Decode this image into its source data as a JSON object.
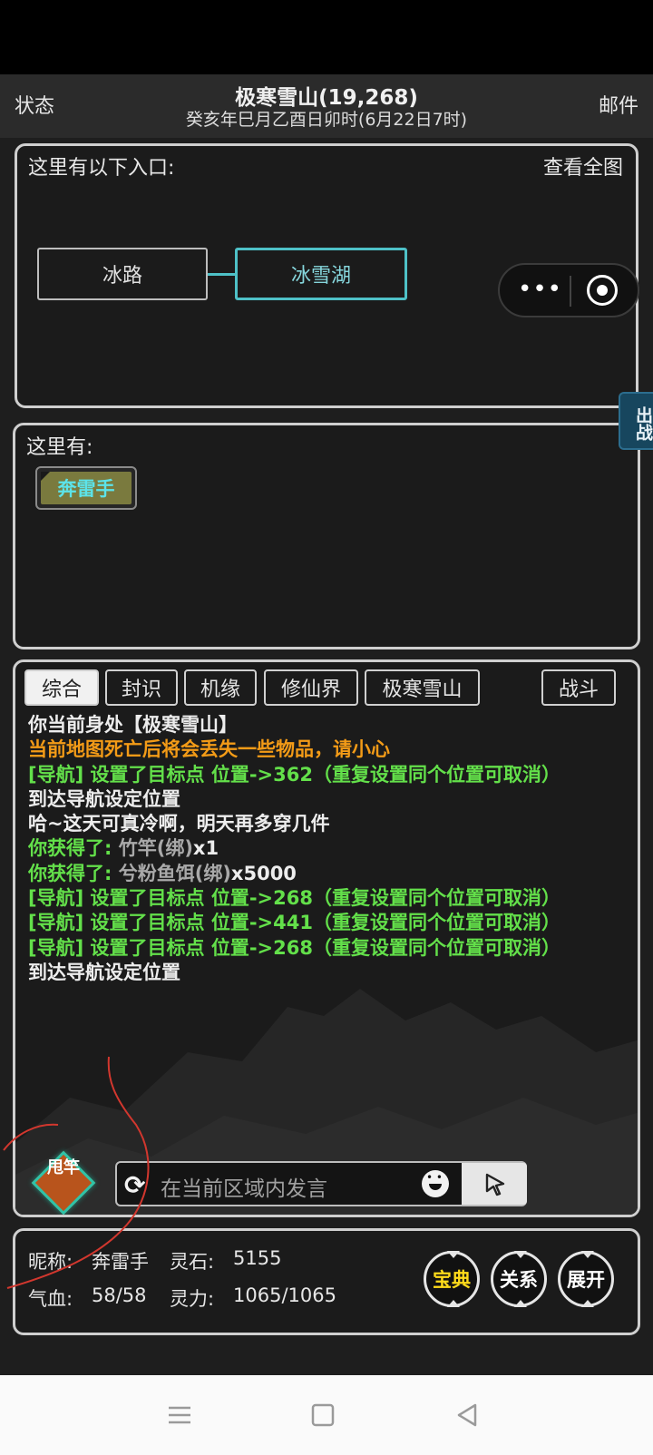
{
  "topbar": {
    "left": "状态",
    "title": "极寒雪山(19,268)",
    "subtitle": "癸亥年巳月乙酉日卯时(6月22日7时)",
    "right": "邮件"
  },
  "exits_panel": {
    "header": "这里有以下入口:",
    "view_all": "查看全图",
    "exits": [
      "冰路",
      "冰雪湖"
    ]
  },
  "capsule": {
    "more": "•••"
  },
  "fight_tab": "出战",
  "here_panel": {
    "header": "这里有:",
    "npc": "奔雷手"
  },
  "chat": {
    "tabs": [
      "综合",
      "封识",
      "机缘",
      "修仙界",
      "极寒雪山",
      "战斗"
    ],
    "active_tab": "综合",
    "log": [
      {
        "parts": [
          {
            "text": "你当前身处【极寒雪山】",
            "color": "white"
          }
        ]
      },
      {
        "parts": [
          {
            "text": "当前地图死亡后将会丢失一些物品，请小心",
            "color": "orange"
          }
        ]
      },
      {
        "parts": [
          {
            "text": "[导航] 设置了目标点 位置->362（重复设置同个位置可取消）",
            "color": "green"
          }
        ]
      },
      {
        "parts": [
          {
            "text": "到达导航设定位置",
            "color": "white"
          }
        ]
      },
      {
        "parts": [
          {
            "text": "哈~这天可真冷啊，明天再多穿几件",
            "color": "white"
          }
        ]
      },
      {
        "parts": [
          {
            "text": "你获得了: ",
            "color": "green"
          },
          {
            "text": "竹竿(绑)",
            "color": "gray"
          },
          {
            "text": "x1",
            "color": "white"
          }
        ]
      },
      {
        "parts": [
          {
            "text": "你获得了: ",
            "color": "green"
          },
          {
            "text": "兮粉鱼饵(绑)",
            "color": "gray"
          },
          {
            "text": "x5000",
            "color": "white"
          }
        ]
      },
      {
        "parts": [
          {
            "text": "[导航] 设置了目标点 位置->268（重复设置同个位置可取消）",
            "color": "green"
          }
        ]
      },
      {
        "parts": [
          {
            "text": "[导航] 设置了目标点 位置->441（重复设置同个位置可取消）",
            "color": "green"
          }
        ]
      },
      {
        "parts": [
          {
            "text": "[导航] 设置了目标点 位置->268（重复设置同个位置可取消）",
            "color": "green"
          }
        ]
      },
      {
        "parts": [
          {
            "text": "到达导航设定位置",
            "color": "white"
          }
        ]
      }
    ],
    "rod_button": "甩竿",
    "input_placeholder": "在当前区域内发言"
  },
  "player": {
    "nickname_label": "昵称:",
    "nickname": "奔雷手",
    "spirit_stone_label": "灵石:",
    "spirit_stone": "5155",
    "hp_label": "气血:",
    "hp": "58/58",
    "mana_label": "灵力:",
    "mana": "1065/1065",
    "buttons": [
      "宝典",
      "关系",
      "展开"
    ]
  },
  "colors": {
    "white": "#ededed",
    "orange": "#f39b17",
    "green": "#63e04a",
    "gray": "#a9a9a9",
    "cyan": "#4ec1c7",
    "gold": "#ffdb1a"
  }
}
